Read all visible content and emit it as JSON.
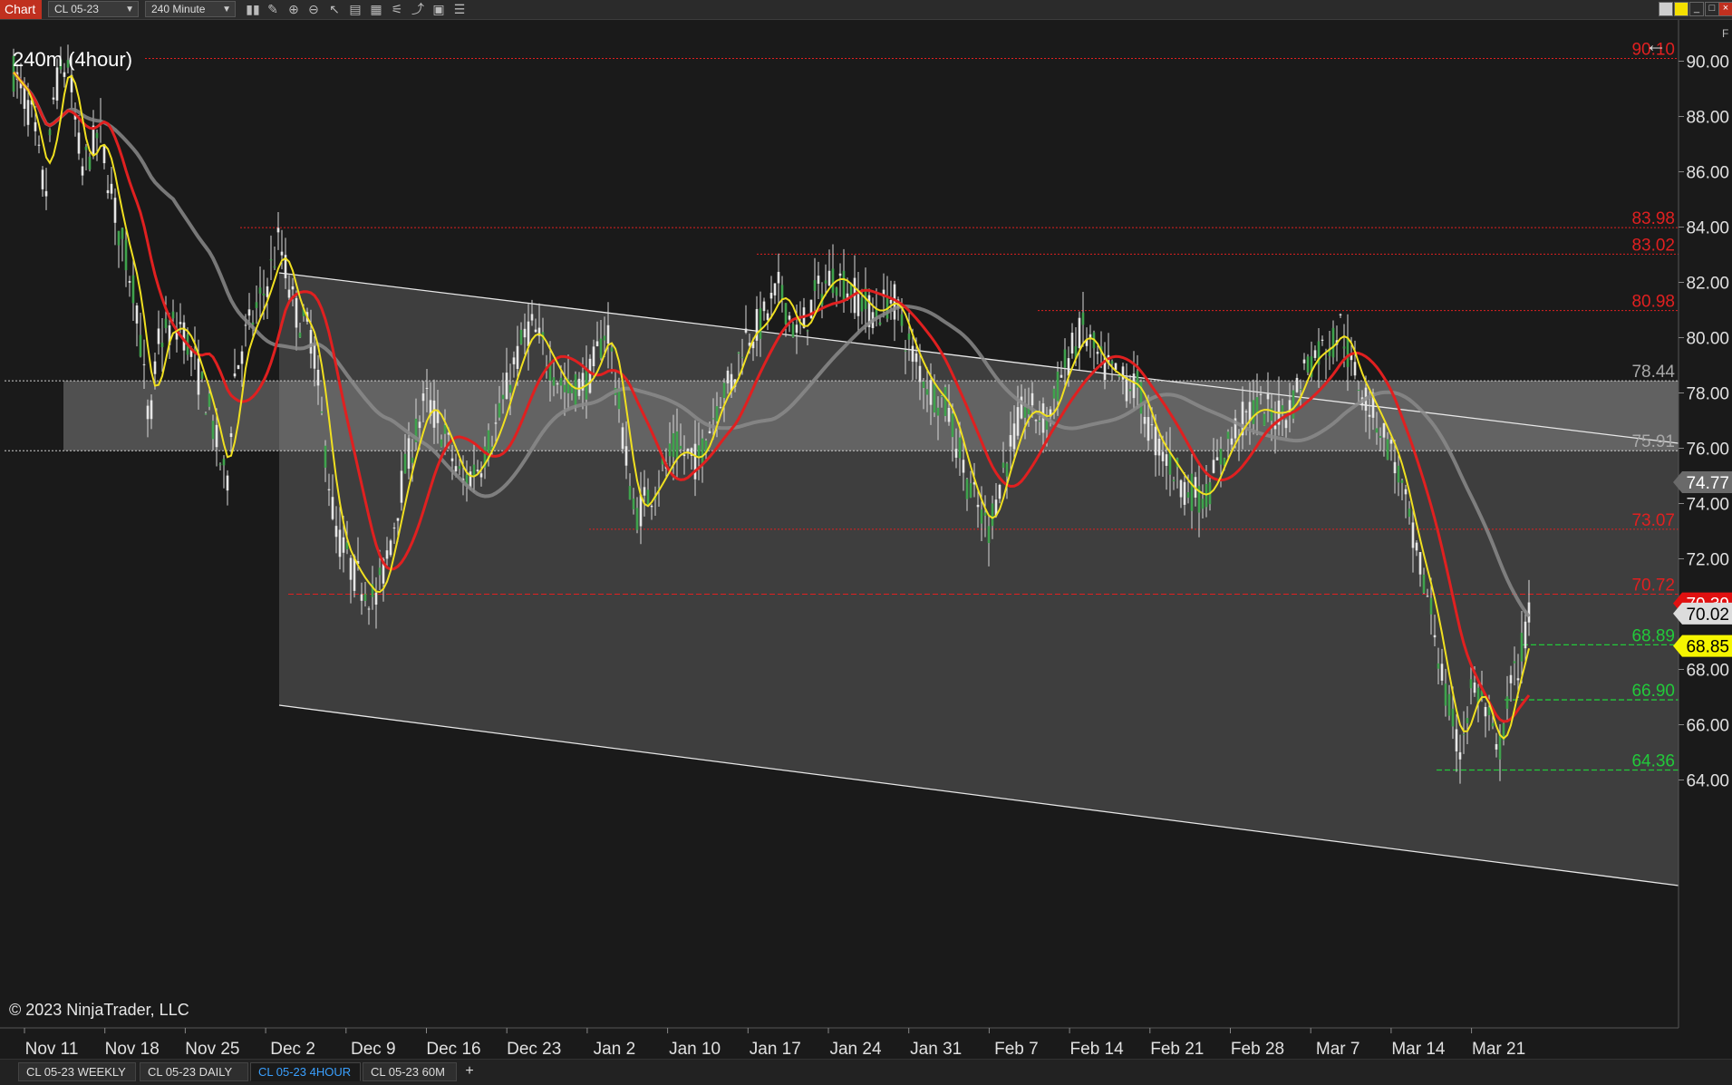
{
  "toolbar": {
    "chart_tab": "Chart",
    "instrument": "CL 05-23",
    "interval": "240 Minute",
    "icons": [
      "bar-style-icon",
      "draw-pencil-icon",
      "zoom-in-icon",
      "zoom-out-icon",
      "pointer-icon",
      "data-box-icon",
      "properties-icon",
      "indicators-icon",
      "strategies-icon",
      "templates-icon",
      "list-icon"
    ],
    "right_letter": "F"
  },
  "chart": {
    "label": "240m (4hour)",
    "copyright": "© 2023 NinjaTrader, LLC",
    "y_ticks": [
      "90.00",
      "88.00",
      "86.00",
      "84.00",
      "82.00",
      "80.00",
      "78.00",
      "76.00",
      "74.00",
      "72.00",
      "70.00",
      "68.00",
      "66.00",
      "64.00"
    ],
    "x_ticks": [
      "Nov 11",
      "Nov 18",
      "Nov 25",
      "Dec 2",
      "Dec 9",
      "Dec 16",
      "Dec 23",
      "Jan 2",
      "Jan 10",
      "Jan 17",
      "Jan 24",
      "Jan 31",
      "Feb 7",
      "Feb 14",
      "Feb 21",
      "Feb 28",
      "Mar 7",
      "Mar 14",
      "Mar 21"
    ],
    "red_levels": [
      "90.10",
      "83.98",
      "83.02",
      "80.98",
      "73.07",
      "70.72"
    ],
    "gray_levels": [
      "78.44",
      "75.91"
    ],
    "green_levels": [
      "68.89",
      "66.90",
      "64.36"
    ],
    "price_markers": [
      {
        "value": "74.77",
        "bg": "#6a6a6a",
        "fg": "#ffffff"
      },
      {
        "value": "70.39",
        "bg": "#e01010",
        "fg": "#ffffff"
      },
      {
        "value": "70.02",
        "bg": "#dcdcdc",
        "fg": "#000000"
      },
      {
        "value": "68.85",
        "bg": "#f5f500",
        "fg": "#000000"
      }
    ],
    "colors": {
      "red": "#e02020",
      "green": "#22c93a",
      "gray": "#9a9a9a",
      "yellow": "#f0e020",
      "slow_ma": "#8a8a8a"
    }
  },
  "tabs": [
    "CL 05-23 WEEKLY",
    "CL 05-23 DAILY",
    "CL 05-23 4HOUR",
    "CL 05-23 60M"
  ],
  "active_tab": 2,
  "add_tab": "+"
}
